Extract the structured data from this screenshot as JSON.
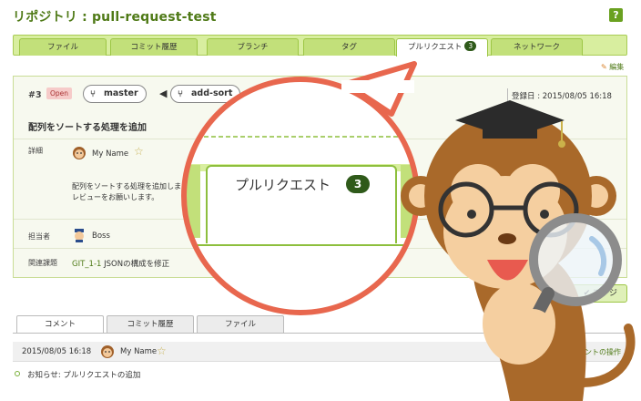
{
  "header": {
    "title": "リポジトリ : pull-request-test",
    "help": "?"
  },
  "tabs": [
    {
      "label": "ファイル"
    },
    {
      "label": "コミット履歴"
    },
    {
      "label": "ブランチ"
    },
    {
      "label": "タグ"
    },
    {
      "label": "プルリクエスト",
      "badge": "3",
      "active": true
    },
    {
      "label": "ネットワーク"
    }
  ],
  "edit_label": "編集",
  "pull_request": {
    "number": "#3",
    "status": "Open",
    "target_branch": "master",
    "source_branch": "add-sort",
    "registered": "登録日 : 2015/08/05 16:18",
    "title": "配列をソートする処理を追加",
    "detail_label": "詳細",
    "author": "My Name",
    "description_line1": "配列をソートする処理を追加しま",
    "description_line2": "レビューをお願いします。",
    "assignee_label": "担当者",
    "assignee": "Boss",
    "related_label": "関連課題",
    "related_issue_key": "GIT_1-1",
    "related_issue_title": "JSONの構成を修正"
  },
  "merge_button": "マージ",
  "bottom_tabs": [
    {
      "label": "コメント",
      "active": true
    },
    {
      "label": "コミット履歴"
    },
    {
      "label": "ファイル"
    }
  ],
  "comment": {
    "date": "2015/08/05 16:18",
    "author": "My Name",
    "ops": "ントの操作",
    "notice": "お知らせ: プルリクエストの追加"
  },
  "zoom": {
    "label": "プルリクエスト",
    "badge": "3"
  },
  "colors": {
    "brand_green": "#4f7a17",
    "tab_green": "#c2e07a",
    "callout_red": "#e8674e",
    "badge_dark": "#2f5a1a"
  }
}
